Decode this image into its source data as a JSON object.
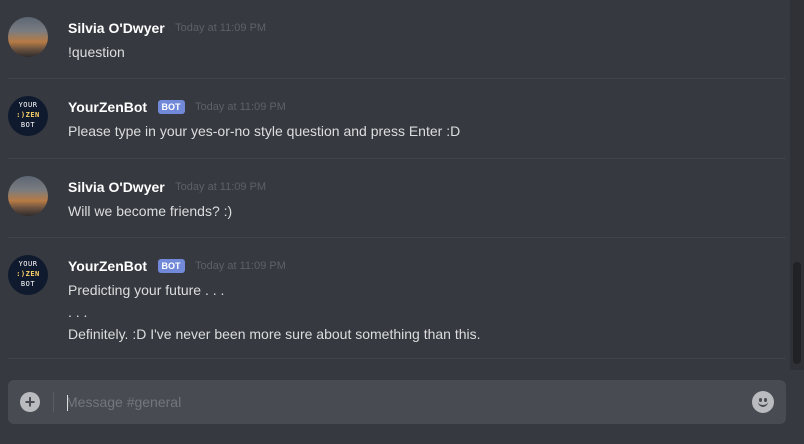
{
  "channel": {
    "name": "general"
  },
  "messages": [
    {
      "author": "Silvia O'Dwyer",
      "timestamp": "Today at 11:09 PM",
      "lines": [
        "!question"
      ],
      "avatar": "user-photo-avatar"
    },
    {
      "author": "YourZenBot",
      "badge": "BOT",
      "timestamp": "Today at 11:09 PM",
      "lines": [
        "Please type in your yes-or-no style question and press Enter :D"
      ],
      "avatar": "bot-avatar",
      "avatar_text": [
        "YOUR",
        ":)ZEN",
        "BOT"
      ]
    },
    {
      "author": "Silvia O'Dwyer",
      "timestamp": "Today at 11:09 PM",
      "lines": [
        "Will we become friends? :)"
      ],
      "avatar": "user-photo-avatar"
    },
    {
      "author": "YourZenBot",
      "badge": "BOT",
      "timestamp": "Today at 11:09 PM",
      "lines": [
        "Predicting your future . . .",
        ". . .",
        "Definitely. :D I've never been more sure about something than this."
      ],
      "avatar": "bot-avatar",
      "avatar_text": [
        "YOUR",
        ":)ZEN",
        "BOT"
      ]
    }
  ],
  "composer": {
    "placeholder": "Message #general",
    "value": "",
    "add_icon": "plus-circle-icon",
    "emoji_icon": "smile-emoji-icon"
  },
  "colors": {
    "background": "#36393f",
    "composer": "#484c52",
    "bot_badge": "#7289da",
    "author": "#ffffff",
    "timestamp": "#5d6167",
    "text": "#dcddde"
  }
}
